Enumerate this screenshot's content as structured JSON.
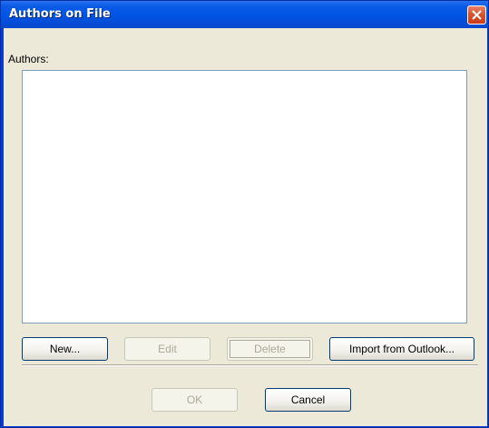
{
  "window": {
    "title": "Authors on File"
  },
  "authors": {
    "label": "Authors:",
    "items": []
  },
  "buttons": {
    "new": "New...",
    "edit": "Edit",
    "delete": "Delete",
    "import": "Import from Outlook...",
    "ok": "OK",
    "cancel": "Cancel"
  },
  "icons": {
    "close": "close-icon"
  },
  "colors": {
    "titlebar": "#0054e3",
    "client": "#ece9d8",
    "close_button": "#d9542d"
  }
}
